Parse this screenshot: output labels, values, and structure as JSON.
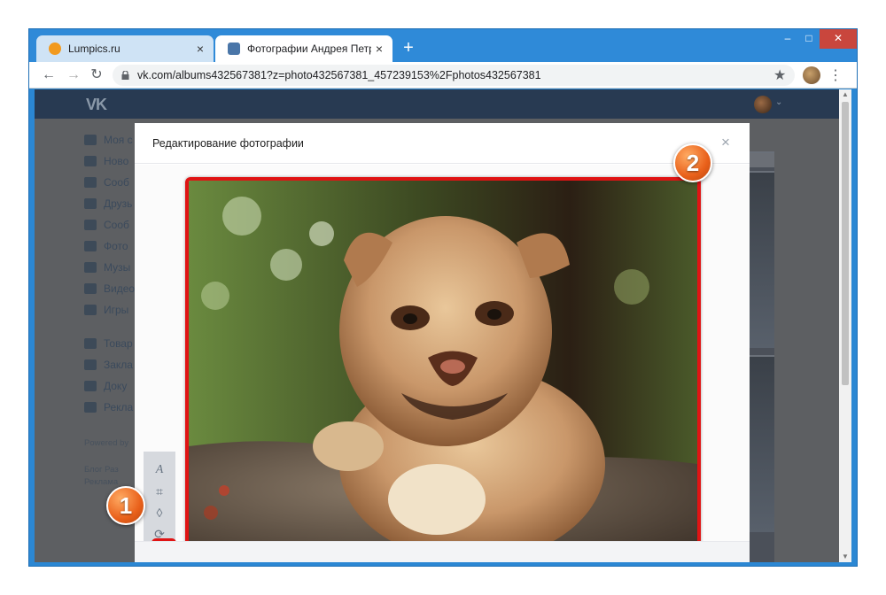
{
  "browser": {
    "tabs": [
      {
        "title": "Lumpics.ru",
        "favicon_color": "#f29a1f",
        "active": false
      },
      {
        "title": "Фотографии Андрея Петрова –",
        "favicon_color": "#4a76a8",
        "active": true
      }
    ],
    "new_tab": "+",
    "window_controls": {
      "minimize": "–",
      "maximize": "□",
      "close": "✕"
    },
    "nav": {
      "back": "←",
      "forward": "→",
      "reload": "↻"
    },
    "url": "vk.com/albums432567381?z=photo432567381_457239153%2Fphotos432567381",
    "bookmark_icon": "★",
    "menu_icon": "⋮"
  },
  "vk": {
    "logo": "VK",
    "sidebar": {
      "items": [
        {
          "label": "Моя с",
          "icon": "home-icon"
        },
        {
          "label": "Ново",
          "icon": "news-icon"
        },
        {
          "label": "Сооб",
          "icon": "message-icon"
        },
        {
          "label": "Друзь",
          "icon": "friends-icon"
        },
        {
          "label": "Сооб",
          "icon": "community-icon"
        },
        {
          "label": "Фото",
          "icon": "camera-icon"
        },
        {
          "label": "Музы",
          "icon": "music-icon"
        },
        {
          "label": "Видео",
          "icon": "video-icon"
        },
        {
          "label": "Игры",
          "icon": "game-icon"
        }
      ],
      "items2": [
        {
          "label": "Товар",
          "icon": "shop-icon"
        },
        {
          "label": "Закла",
          "icon": "bookmark-icon"
        },
        {
          "label": "Доку",
          "icon": "document-icon"
        },
        {
          "label": "Рекла",
          "icon": "ads-icon"
        }
      ],
      "powered": "Powered by",
      "footer_line1": "Блог  Раз",
      "footer_line2": "Реклама"
    }
  },
  "modal": {
    "title": "Редактирование фотографии",
    "close": "×",
    "tools": [
      {
        "name": "text-tool-icon",
        "glyph": "A"
      },
      {
        "name": "crop-tool-icon",
        "glyph": "⌗"
      },
      {
        "name": "blur-tool-icon",
        "glyph": "◊"
      },
      {
        "name": "rotate-tool-icon",
        "glyph": "⟳"
      },
      {
        "name": "brightness-tool-icon",
        "glyph": "☀"
      }
    ]
  },
  "markers": {
    "one": "1",
    "two": "2"
  },
  "accent_color": "#e01414",
  "marker_color": "#e9601a"
}
